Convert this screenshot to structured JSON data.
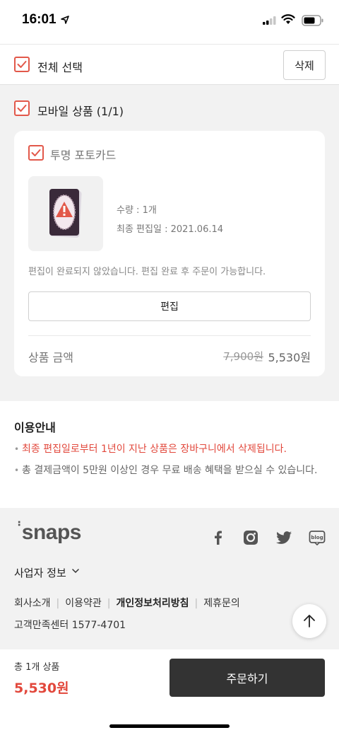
{
  "status_bar": {
    "time": "16:01"
  },
  "cart": {
    "select_all_label": "전체 선택",
    "delete_label": "삭제",
    "group_label": "모바일 상품 (1/1)",
    "item": {
      "name": "투명 포토카드",
      "quantity_text": "수량 : 1개",
      "edited_date_text": "최종 편집일 : 2021.06.14",
      "notice": "편집이 완료되지 않았습니다. 편집 완료 후 주문이 가능합니다.",
      "edit_label": "편집",
      "price_label": "상품 금액",
      "original_price": "7,900원",
      "final_price": "5,530원"
    }
  },
  "usage": {
    "title": "이용안내",
    "notes": [
      "최종 편집일로부터 1년이 지난 상품은 장바구니에서 삭제됩니다.",
      "총 결제금액이 5만원 이상인 경우 무료 배송 혜택을 받으실 수 있습니다."
    ]
  },
  "footer": {
    "logo": "snaps",
    "business_info_label": "사업자 정보",
    "links": [
      "회사소개",
      "이용약관",
      "개인정보처리방침",
      "제휴문의"
    ],
    "customer_center": "고객만족센터 1577-4701",
    "social": [
      "facebook-icon",
      "instagram-icon",
      "twitter-icon",
      "blog-icon"
    ],
    "blog_text": "blog"
  },
  "order_bar": {
    "total_label": "총 1개 상품",
    "total_price": "5,530원",
    "order_label": "주문하기"
  },
  "colors": {
    "accent": "#e2584a",
    "price_red": "#e2483c",
    "order_button": "#333333",
    "gray_bg": "#f2f2f2"
  }
}
